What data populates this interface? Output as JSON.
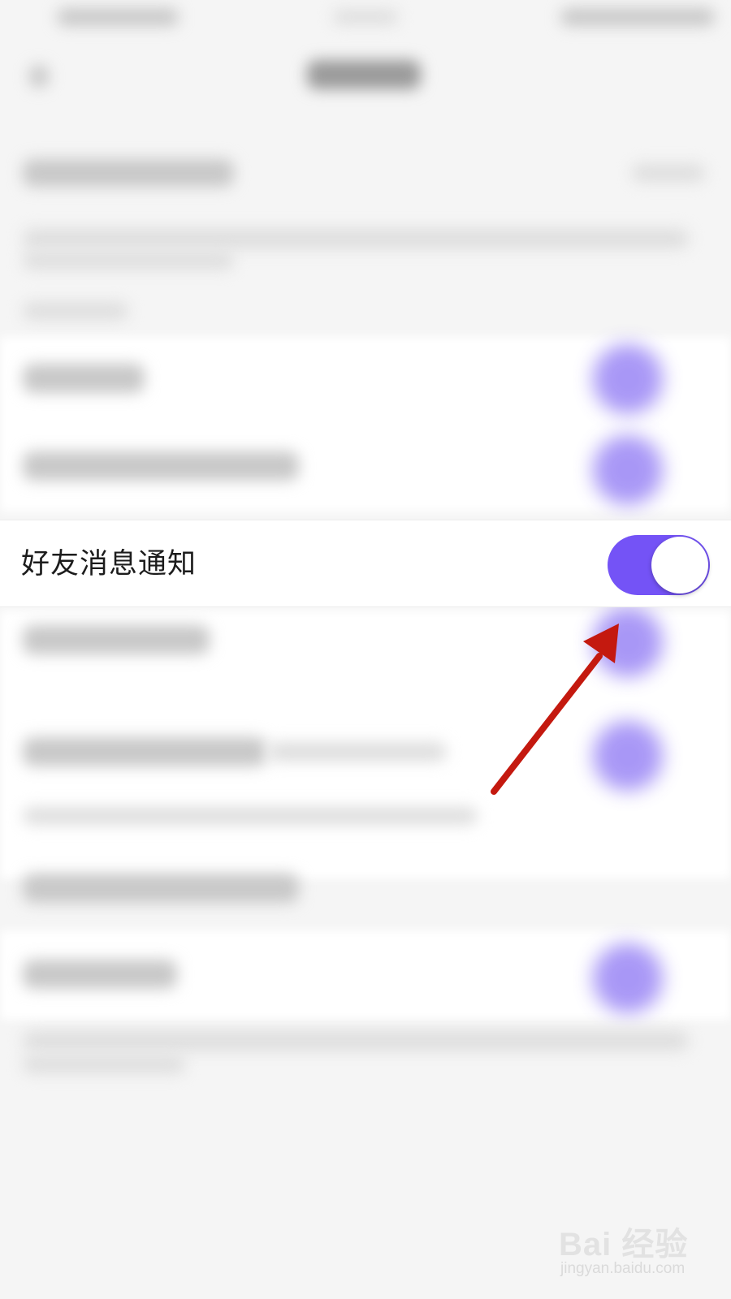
{
  "settings": {
    "highlighted_item": {
      "label": "好友消息通知",
      "toggle_on": true
    }
  },
  "colors": {
    "toggle_track_on": "#7453f6",
    "toggle_knob": "#ffffff",
    "annotation_arrow": "#c4190f"
  },
  "icons": {
    "annotation": "arrow-icon"
  },
  "watermark": {
    "brand": "Bai 经验",
    "url": "jingyan.baidu.com"
  }
}
